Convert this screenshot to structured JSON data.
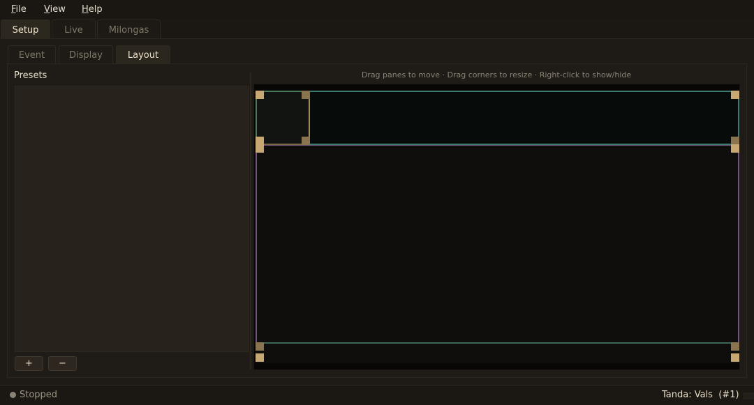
{
  "menu": [
    {
      "label": "File",
      "underline": "F",
      "rest": "ile"
    },
    {
      "label": "View",
      "underline": "V",
      "rest": "iew"
    },
    {
      "label": "Help",
      "underline": "H",
      "rest": "elp"
    }
  ],
  "main_tabs": [
    "Setup",
    "Live",
    "Milongas"
  ],
  "main_tabs_active": "Setup",
  "sub_tabs": [
    "Event",
    "Display",
    "Layout"
  ],
  "sub_tabs_active": "Layout",
  "presets": {
    "label": "Presets",
    "items": [],
    "add_label": "+",
    "remove_label": "−"
  },
  "layout_editor": {
    "hint": "Drag panes to move · Drag corners to resize · Right-click to show/hide"
  },
  "status": {
    "state": "Stopped",
    "tanda": "Tanda: Vals  (#1)"
  },
  "colors": {
    "accent": "#c7a872",
    "top_pane_border": "#3e7a6f",
    "main_pane_border": "#75517e",
    "logo_pane_border": "#4e7a5c"
  }
}
